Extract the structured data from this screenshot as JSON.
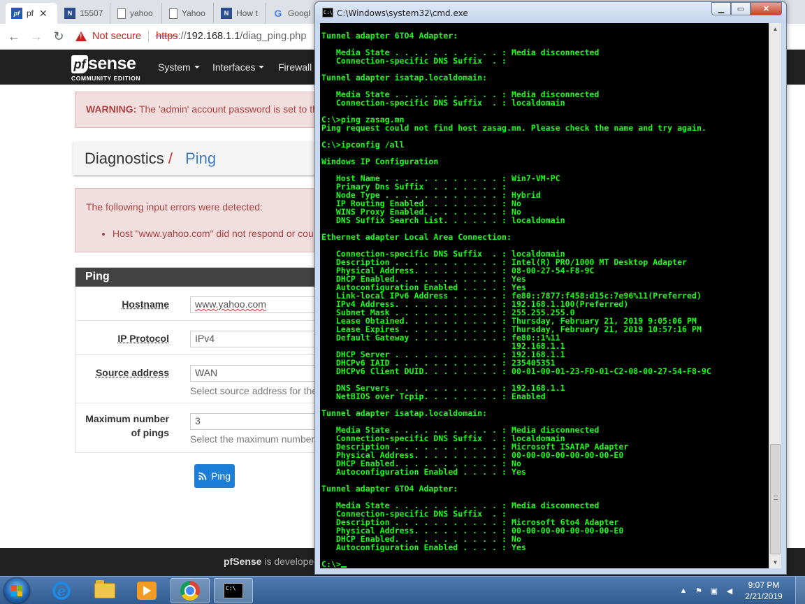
{
  "browser": {
    "tabs": [
      {
        "title": "pf",
        "icon": "pfsense-favicon"
      },
      {
        "title": "15507",
        "icon": "netgate-favicon"
      },
      {
        "title": "yahoo",
        "icon": "document-favicon"
      },
      {
        "title": "Yahoo",
        "icon": "document-favicon"
      },
      {
        "title": "How t",
        "icon": "netgate-favicon"
      },
      {
        "title": "Googl",
        "icon": "google-favicon"
      }
    ],
    "omnibox": {
      "security_label": "Not secure",
      "url_scheme": "https",
      "url_sep": "://",
      "url_host": "192.168.1.1",
      "url_path": "/diag_ping.php"
    }
  },
  "pfsense": {
    "logo_word": "sense",
    "logo_mark": "pf",
    "logo_edition": "COMMUNITY EDITION",
    "menu": [
      "System",
      "Interfaces",
      "Firewall"
    ],
    "warning_label": "WARNING:",
    "warning_text": "The 'admin' account password is set to th",
    "breadcrumb_section": "Diagnostics",
    "breadcrumb_sep": "/",
    "breadcrumb_page": "Ping",
    "errors_title": "The following input errors were detected:",
    "errors": [
      "Host \"www.yahoo.com\" did not respond or cou"
    ],
    "panel_title": "Ping",
    "form": {
      "hostname_label": "Hostname",
      "hostname_value": "www.yahoo.com",
      "protocol_label": "IP Protocol",
      "protocol_value": "IPv4",
      "source_label": "Source address",
      "source_value": "WAN",
      "source_help": "Select source address for the",
      "count_label_1": "Maximum number",
      "count_label_2": "of pings",
      "count_value": "3",
      "count_help": "Select the maximum number"
    },
    "ping_button": "Ping",
    "footer_brand": "pfSense",
    "footer_text": " is developed"
  },
  "cmd": {
    "title": "C:\\Windows\\system32\\cmd.exe",
    "title_icon": "C:\\",
    "lines": [
      "Tunnel adapter 6TO4 Adapter:",
      "",
      "   Media State . . . . . . . . . . . : Media disconnected",
      "   Connection-specific DNS Suffix  . :",
      "",
      "Tunnel adapter isatap.localdomain:",
      "",
      "   Media State . . . . . . . . . . . : Media disconnected",
      "   Connection-specific DNS Suffix  . : localdomain",
      "",
      "C:\\>ping zasag.mn",
      "Ping request could not find host zasag.mn. Please check the name and try again.",
      "",
      "C:\\>ipconfig /all",
      "",
      "Windows IP Configuration",
      "",
      "   Host Name . . . . . . . . . . . . : Win7-VM-PC",
      "   Primary Dns Suffix  . . . . . . . :",
      "   Node Type . . . . . . . . . . . . : Hybrid",
      "   IP Routing Enabled. . . . . . . . : No",
      "   WINS Proxy Enabled. . . . . . . . : No",
      "   DNS Suffix Search List. . . . . . : localdomain",
      "",
      "Ethernet adapter Local Area Connection:",
      "",
      "   Connection-specific DNS Suffix  . : localdomain",
      "   Description . . . . . . . . . . . : Intel(R) PRO/1000 MT Desktop Adapter",
      "   Physical Address. . . . . . . . . : 08-00-27-54-F8-9C",
      "   DHCP Enabled. . . . . . . . . . . : Yes",
      "   Autoconfiguration Enabled . . . . : Yes",
      "   Link-local IPv6 Address . . . . . : fe80::7877:f458:d15c:7e96%11(Preferred)",
      "   IPv4 Address. . . . . . . . . . . : 192.168.1.100(Preferred)",
      "   Subnet Mask . . . . . . . . . . . : 255.255.255.0",
      "   Lease Obtained. . . . . . . . . . : Thursday, February 21, 2019 9:05:06 PM",
      "   Lease Expires . . . . . . . . . . : Thursday, February 21, 2019 10:57:16 PM",
      "   Default Gateway . . . . . . . . . : fe80::1%11",
      "                                       192.168.1.1",
      "   DHCP Server . . . . . . . . . . . : 192.168.1.1",
      "   DHCPv6 IAID . . . . . . . . . . . : 235405351",
      "   DHCPv6 Client DUID. . . . . . . . : 00-01-00-01-23-FD-01-C2-08-00-27-54-F8-9C",
      "",
      "   DNS Servers . . . . . . . . . . . : 192.168.1.1",
      "   NetBIOS over Tcpip. . . . . . . . : Enabled",
      "",
      "Tunnel adapter isatap.localdomain:",
      "",
      "   Media State . . . . . . . . . . . : Media disconnected",
      "   Connection-specific DNS Suffix  . : localdomain",
      "   Description . . . . . . . . . . . : Microsoft ISATAP Adapter",
      "   Physical Address. . . . . . . . . : 00-00-00-00-00-00-00-E0",
      "   DHCP Enabled. . . . . . . . . . . : No",
      "   Autoconfiguration Enabled . . . . : Yes",
      "",
      "Tunnel adapter 6TO4 Adapter:",
      "",
      "   Media State . . . . . . . . . . . : Media disconnected",
      "   Connection-specific DNS Suffix  . :",
      "   Description . . . . . . . . . . . : Microsoft 6to4 Adapter",
      "   Physical Address. . . . . . . . . : 00-00-00-00-00-00-00-E0",
      "   DHCP Enabled. . . . . . . . . . . : No",
      "   Autoconfiguration Enabled . . . . : Yes",
      "",
      "C:\\>"
    ]
  },
  "taskbar": {
    "time": "9:07 PM",
    "date": "2/21/2019"
  },
  "colors": {
    "console_text": "#16ff16",
    "pfsense_nav": "#212121",
    "ping_button": "#1c7ed6",
    "alert_text": "#a94442"
  }
}
